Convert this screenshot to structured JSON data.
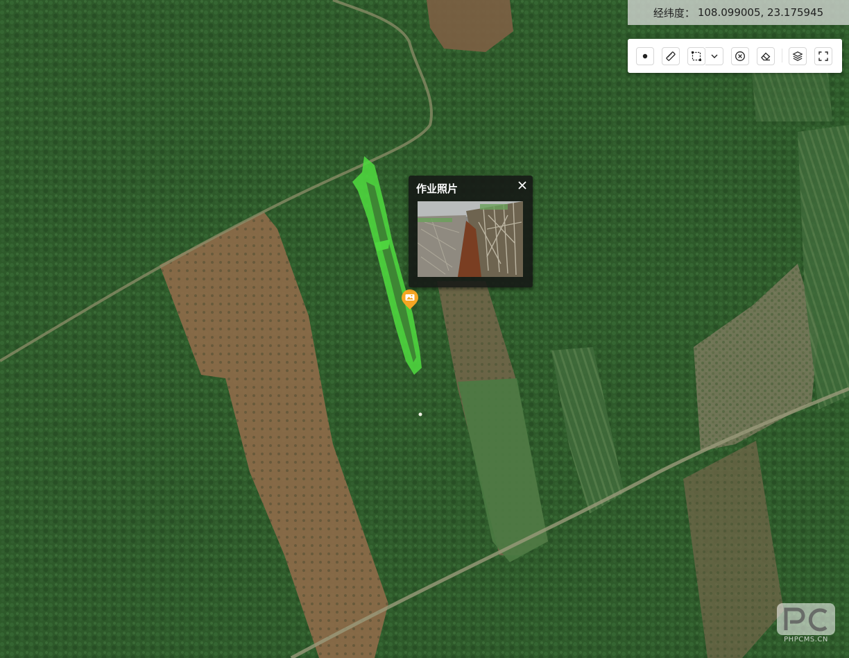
{
  "coordinate_readout": {
    "label": "经纬度：",
    "value": "108.099005, 23.175945"
  },
  "toolbar": {
    "buttons": [
      {
        "name": "draw-point",
        "icon": "point-icon"
      },
      {
        "name": "measure-distance",
        "icon": "ruler-icon"
      },
      {
        "name": "draw-rectangle",
        "icon": "rectangle-select-icon"
      },
      {
        "name": "draw-options",
        "icon": "chevron-down-icon"
      },
      {
        "name": "clear",
        "icon": "close-circle-icon"
      },
      {
        "name": "erase",
        "icon": "eraser-icon"
      },
      {
        "name": "layers",
        "icon": "layers-icon"
      },
      {
        "name": "fullscreen",
        "icon": "fullscreen-icon"
      }
    ]
  },
  "popup": {
    "title": "作业照片",
    "close_icon": "close-icon",
    "photo": "field-work-photo"
  },
  "map": {
    "basemap": "satellite",
    "track_color": "#4fd83f",
    "marker_color": "#f5a623",
    "marker_icon": "image-marker-icon"
  },
  "watermark": {
    "text": "PHPCMS.CN"
  }
}
